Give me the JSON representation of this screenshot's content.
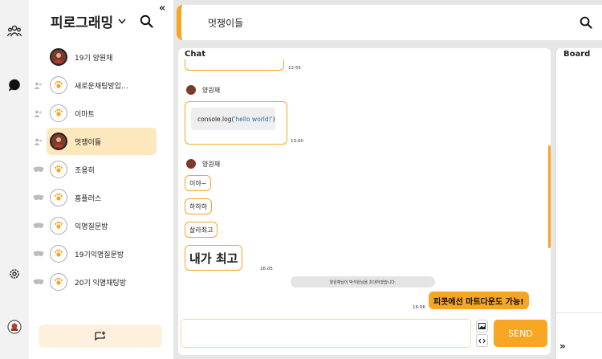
{
  "rail": {
    "items": [
      {
        "icon": "community-icon"
      },
      {
        "icon": "chat-bubble-icon"
      },
      {
        "icon": "settings-icon"
      },
      {
        "icon": "user-avatar-icon"
      }
    ]
  },
  "sidebar": {
    "title": "피로그래밍",
    "dropdown_icon": "chevron-down-icon",
    "collapse_label": "«",
    "rooms": [
      {
        "name": "19기 양원채",
        "type": "dm",
        "avatar": "photo",
        "active": false
      },
      {
        "name": "새로운채팅방입…",
        "type": "group",
        "avatar": "logo",
        "active": false
      },
      {
        "name": "이마트",
        "type": "group",
        "avatar": "logo",
        "active": false
      },
      {
        "name": "멋쟁이들",
        "type": "group",
        "avatar": "photo",
        "active": true
      },
      {
        "name": "조용히",
        "type": "anonymous",
        "avatar": "logo",
        "active": false
      },
      {
        "name": "홈플러스",
        "type": "anonymous",
        "avatar": "logo",
        "active": false
      },
      {
        "name": "익명질문방",
        "type": "anonymous",
        "avatar": "logo",
        "active": false
      },
      {
        "name": "19기익명질문방",
        "type": "anonymous",
        "avatar": "logo",
        "active": false
      },
      {
        "name": "20기 익명채팅방",
        "type": "anonymous",
        "avatar": "logo",
        "active": false
      }
    ]
  },
  "header": {
    "room_title": "멋쟁이들"
  },
  "chat": {
    "label": "Chat",
    "messages": [
      {
        "time": "12:55"
      },
      {
        "sender": "양원채",
        "code_prefix": "console.log(",
        "code_string": "'hello world!'",
        "code_suffix": ")",
        "time": "13:00"
      },
      {
        "sender": "양원채",
        "bubbles": [
          "이야~",
          "하하하",
          "살라최고",
          "내가 최고"
        ],
        "time": "16:05"
      },
      {
        "notice": "양원채님이 박석원님을 초대하였습니다."
      },
      {
        "mine": "피콧에선 마트다운도 가능!",
        "time": "16:06"
      }
    ],
    "input_placeholder": "",
    "send_label": "SEND"
  },
  "board": {
    "label": "Board",
    "expand_label": "»"
  },
  "colors": {
    "accent": "#f6a623",
    "active_room": "#fde7bd",
    "new_chat_bg": "#fdf1dd"
  }
}
